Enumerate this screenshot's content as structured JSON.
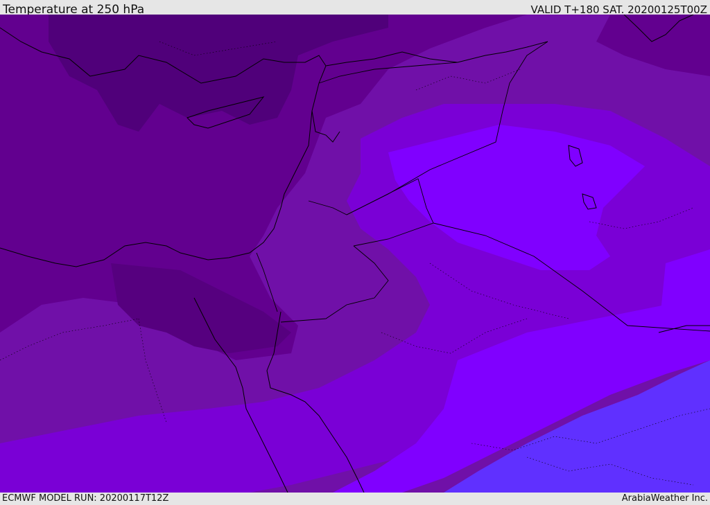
{
  "header": {
    "title": "Temperature at 250 hPa",
    "valid_time": "VALID T+180 SAT. 20200125T00Z"
  },
  "footer": {
    "model_run": "ECMWF MODEL RUN: 20200117T12Z",
    "credit": "ArabiaWeather Inc."
  },
  "colors": {
    "band_darkest": "#50007a",
    "band_dark": "#62008f",
    "band_mid": "#7010a8",
    "band_purple": "#7a00d6",
    "band_violet": "#8000ff",
    "band_blue": "#6030ff",
    "coastline": "#000000",
    "header_bg": "#e6e6e6"
  }
}
